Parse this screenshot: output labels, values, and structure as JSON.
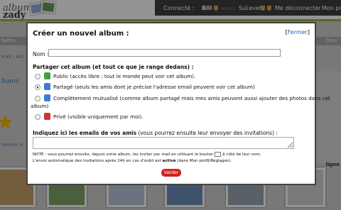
{
  "background": {
    "logo_line1": "album",
    "logo_line2": "zady",
    "userbar": {
      "connected_prefix": "Connecté :",
      "user": "Bill",
      "admin": "Admin",
      "sulevel": "SuLevel :",
      "logout": "Me déconnecter",
      "profile": "Mon pro"
    },
    "nav_left": "bums",
    "nav_right": "foru",
    "breadcrumb_prefix": "s ici :",
    "breadcrumb_link": "Acc",
    "section_title": "bums",
    "create_link": "nouvel a",
    "right_label": "ligne"
  },
  "modal": {
    "title": "Créer un nouvel album :",
    "close_open": "[",
    "close_label": "Fermer",
    "close_end": "]",
    "name_label": "Nom :",
    "name_value": "",
    "share_title": "Partager cet album (et tout ce que je range dedans) :",
    "options": [
      {
        "label": "Public (accès libre : tout le monde peut voir cet album).",
        "checked": false,
        "lock_color": "#3ea33e"
      },
      {
        "label": "Partagé (seuls les amis dont je précise l'adresse email peuvent voir cet album)",
        "checked": true,
        "lock_color": "#3a7cd6"
      },
      {
        "label": "Complètement mutualisé (comme album partagé mais mes amis peuvent aussi ajouter des photos dans cet",
        "label_cont": "album)",
        "checked": false,
        "lock_color": "#3a7cd6"
      },
      {
        "label": "Privé (visible uniquement par moi).",
        "checked": false,
        "lock_color": "#d23131"
      }
    ],
    "emails_label_bold": "Indiquez ici les emails de vos amis",
    "emails_label_rest": "(vous pourrez ensuite leur envoyer des invitations) :",
    "emails_value": "",
    "note_line1_a": "NOTE : vous pourrez ensuite, depuis votre album, les inviter par mail en utilisant le bouton",
    "note_line1_b": "à côté de leur nom.",
    "note_line2_a": "L'envoi automatique des invitations après 24h en cas d'oubli est",
    "note_line2_bold": "activé",
    "note_line2_b": "(dans Mon profil/Réglages).",
    "validate_label": "Valider"
  }
}
